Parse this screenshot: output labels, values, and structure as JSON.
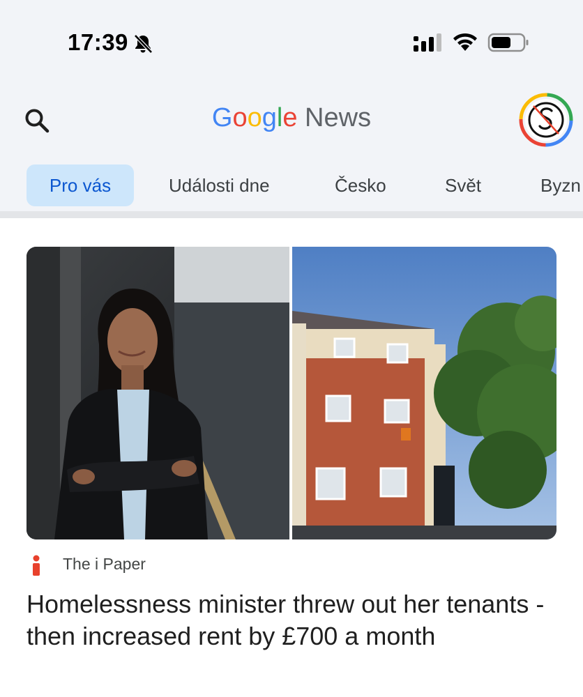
{
  "status_bar": {
    "time": "17:39",
    "icons": [
      "bell-off-icon",
      "cellular-signal-icon",
      "wifi-icon",
      "battery-icon"
    ]
  },
  "app_bar": {
    "brand_google": [
      "G",
      "o",
      "o",
      "g",
      "l",
      "e"
    ],
    "brand_news": "News",
    "search_icon": "search-icon",
    "avatar_icon": "account-avatar"
  },
  "tabs": [
    {
      "label": "Pro vás",
      "active": true
    },
    {
      "label": "Události dne",
      "active": false
    },
    {
      "label": "Česko",
      "active": false
    },
    {
      "label": "Svět",
      "active": false
    },
    {
      "label": "Byzn",
      "active": false
    }
  ],
  "article": {
    "source": "The i Paper",
    "headline": "Homelessness minister threw out her tenants - then increased rent by £700 a month"
  },
  "colors": {
    "header_bg": "#f2f4f8",
    "active_tab_bg": "#cde6fb",
    "active_tab_text": "#0b57d0",
    "google_blue": "#4285F4",
    "google_red": "#EA4335",
    "google_yellow": "#FBBC05",
    "google_green": "#34A853",
    "source_red": "#e8412c"
  }
}
